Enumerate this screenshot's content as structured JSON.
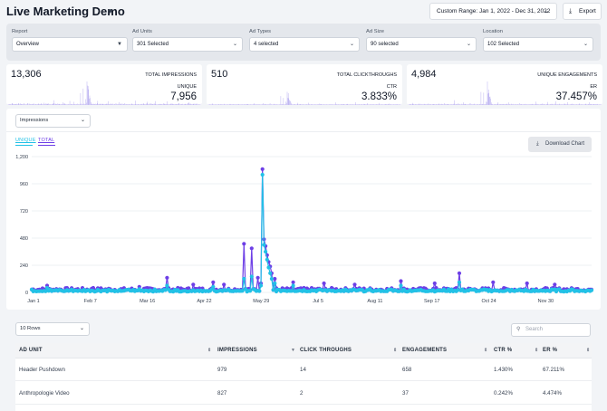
{
  "header": {
    "title": "Live Marketing Demo",
    "date_range": "Custom Range: Jan 1, 2022 - Dec 31, 2022",
    "export_label": "Export"
  },
  "filters": [
    {
      "label": "Report",
      "value": "Overview"
    },
    {
      "label": "Ad Units",
      "value": "301 Selected"
    },
    {
      "label": "Ad Types",
      "value": "4 selected"
    },
    {
      "label": "Ad Size",
      "value": "90 selected"
    },
    {
      "label": "Location",
      "value": "102 Selected"
    }
  ],
  "metrics": [
    {
      "value": "13,306",
      "label": "TOTAL IMPRESSIONS",
      "sub_label": "UNIQUE",
      "sub_value": "7,956"
    },
    {
      "value": "510",
      "label": "TOTAL CLICKTHROUGHS",
      "sub_label": "CTR",
      "sub_value": "3.833%"
    },
    {
      "value": "4,984",
      "label": "UNIQUE ENGAGEMENTS",
      "sub_label": "ER",
      "sub_value": "37.457%"
    }
  ],
  "chart_controls": {
    "metric": "Impressions",
    "legend_unique": "UNIQUE",
    "legend_total": "TOTAL",
    "download_label": "Download Chart"
  },
  "colors": {
    "unique": "#22c1e6",
    "total": "#6d3fe6",
    "spark": "#b8aef0"
  },
  "chart_data": {
    "type": "line",
    "xlabel": "",
    "ylabel": "",
    "ylim": [
      0,
      1200
    ],
    "y_ticks": [
      0,
      240,
      480,
      720,
      960,
      1200
    ],
    "y_tick_labels": [
      "0",
      "240",
      "480",
      "720",
      "960",
      "1,200"
    ],
    "x_ticks": [
      {
        "label": "Jan 1",
        "day": 0
      },
      {
        "label": "Feb 7",
        "day": 37
      },
      {
        "label": "Mar 16",
        "day": 74
      },
      {
        "label": "Apr 22",
        "day": 111
      },
      {
        "label": "May 29",
        "day": 148
      },
      {
        "label": "Jul 5",
        "day": 185
      },
      {
        "label": "Aug 11",
        "day": 222
      },
      {
        "label": "Sep 17",
        "day": 259
      },
      {
        "label": "Oct 24",
        "day": 296
      },
      {
        "label": "Nov 30",
        "day": 333
      }
    ],
    "days_in_range": 365,
    "series": [
      {
        "name": "TOTAL",
        "peaks": [
          [
            10,
            60
          ],
          [
            40,
            40
          ],
          [
            70,
            50
          ],
          [
            88,
            130
          ],
          [
            105,
            70
          ],
          [
            118,
            90
          ],
          [
            125,
            70
          ],
          [
            138,
            430
          ],
          [
            143,
            390
          ],
          [
            147,
            130
          ],
          [
            149,
            80
          ],
          [
            150,
            1090
          ],
          [
            151,
            470
          ],
          [
            152,
            410
          ],
          [
            153,
            330
          ],
          [
            154,
            270
          ],
          [
            155,
            230
          ],
          [
            156,
            170
          ],
          [
            158,
            120
          ],
          [
            170,
            90
          ],
          [
            190,
            80
          ],
          [
            210,
            70
          ],
          [
            240,
            100
          ],
          [
            262,
            80
          ],
          [
            278,
            170
          ],
          [
            300,
            90
          ],
          [
            322,
            80
          ],
          [
            340,
            70
          ]
        ],
        "base": 25
      },
      {
        "name": "UNIQUE",
        "peaks": [
          [
            10,
            40
          ],
          [
            70,
            30
          ],
          [
            88,
            60
          ],
          [
            118,
            50
          ],
          [
            138,
            120
          ],
          [
            143,
            140
          ],
          [
            149,
            60
          ],
          [
            150,
            1040
          ],
          [
            151,
            420
          ],
          [
            152,
            360
          ],
          [
            153,
            290
          ],
          [
            154,
            220
          ],
          [
            155,
            170
          ],
          [
            156,
            120
          ],
          [
            158,
            80
          ],
          [
            170,
            60
          ],
          [
            240,
            60
          ],
          [
            278,
            90
          ]
        ],
        "base": 18
      }
    ]
  },
  "table": {
    "rows_label": "10 Rows",
    "search_placeholder": "Search",
    "columns": [
      "AD UNIT",
      "IMPRESSIONS",
      "CLICK THROUGHS",
      "ENGAGEMENTS",
      "CTR %",
      "ER %"
    ],
    "rows": [
      [
        "Header Pushdown",
        "979",
        "14",
        "658",
        "1.430%",
        "67.211%"
      ],
      [
        "Anthropologie Video",
        "827",
        "2",
        "37",
        "0.242%",
        "4.474%"
      ]
    ]
  }
}
